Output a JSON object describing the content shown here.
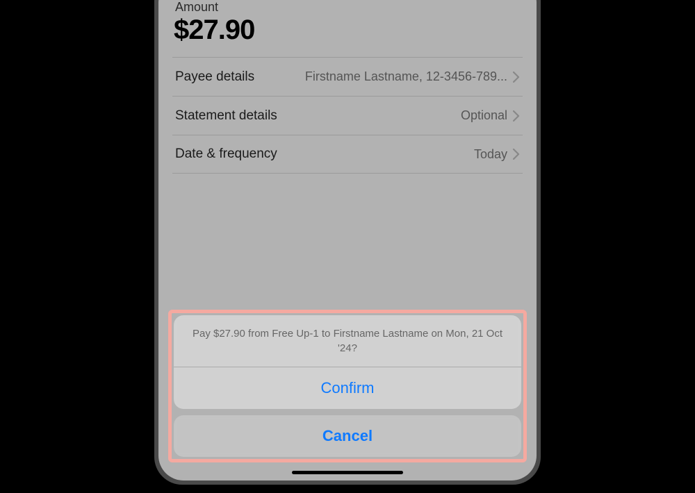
{
  "amount": {
    "label": "Amount",
    "value": "$27.90"
  },
  "rows": {
    "payee": {
      "label": "Payee details",
      "value": "Firstname Lastname, 12-3456-789..."
    },
    "statement": {
      "label": "Statement details",
      "value": "Optional"
    },
    "date": {
      "label": "Date & frequency",
      "value": "Today"
    }
  },
  "sheet": {
    "message": "Pay $27.90 from Free Up-1 to Firstname Lastname on Mon, 21 Oct '24?",
    "confirm": "Confirm",
    "cancel": "Cancel"
  }
}
